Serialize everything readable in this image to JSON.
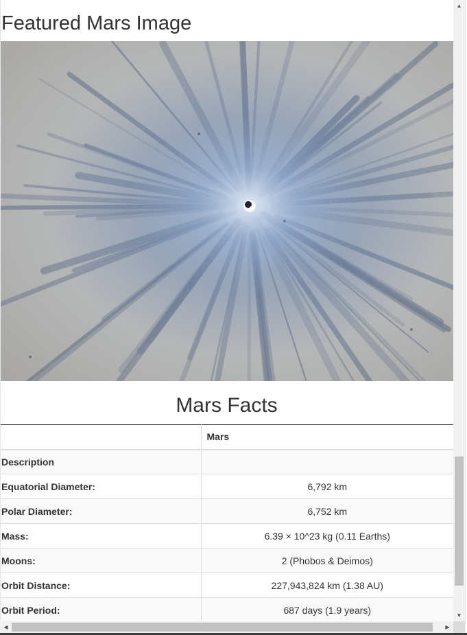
{
  "featured": {
    "heading": "Featured Mars Image",
    "image_description": "Fresh impact crater on Mars with dark blue ray streaks radiating from a bright central crater over a tan-gray surface"
  },
  "facts": {
    "heading": "Mars Facts",
    "table": {
      "header": [
        "",
        "Mars"
      ],
      "rows": [
        {
          "label": "Description",
          "value": ""
        },
        {
          "label": "Equatorial Diameter:",
          "value": "6,792 km"
        },
        {
          "label": "Polar Diameter:",
          "value": "6,752 km"
        },
        {
          "label": "Mass:",
          "value": "6.39 × 10^23 kg (0.11 Earths)"
        },
        {
          "label": "Moons:",
          "value": "2 (Phobos & Deimos)"
        },
        {
          "label": "Orbit Distance:",
          "value": "227,943,824 km (1.38 AU)"
        },
        {
          "label": "Orbit Period:",
          "value": "687 days (1.9 years)"
        }
      ]
    }
  },
  "colors": {
    "text": "#333333",
    "table_border": "#dddddd",
    "striped_row": "#f9f9f9",
    "scrollbar_track": "#f1f1f1",
    "scrollbar_thumb": "#c1c1c1"
  },
  "icons": {
    "scroll_up": "scroll-up-arrow-icon",
    "scroll_down": "scroll-down-arrow-icon",
    "scroll_left": "scroll-left-arrow-icon",
    "scroll_right": "scroll-right-arrow-icon"
  }
}
